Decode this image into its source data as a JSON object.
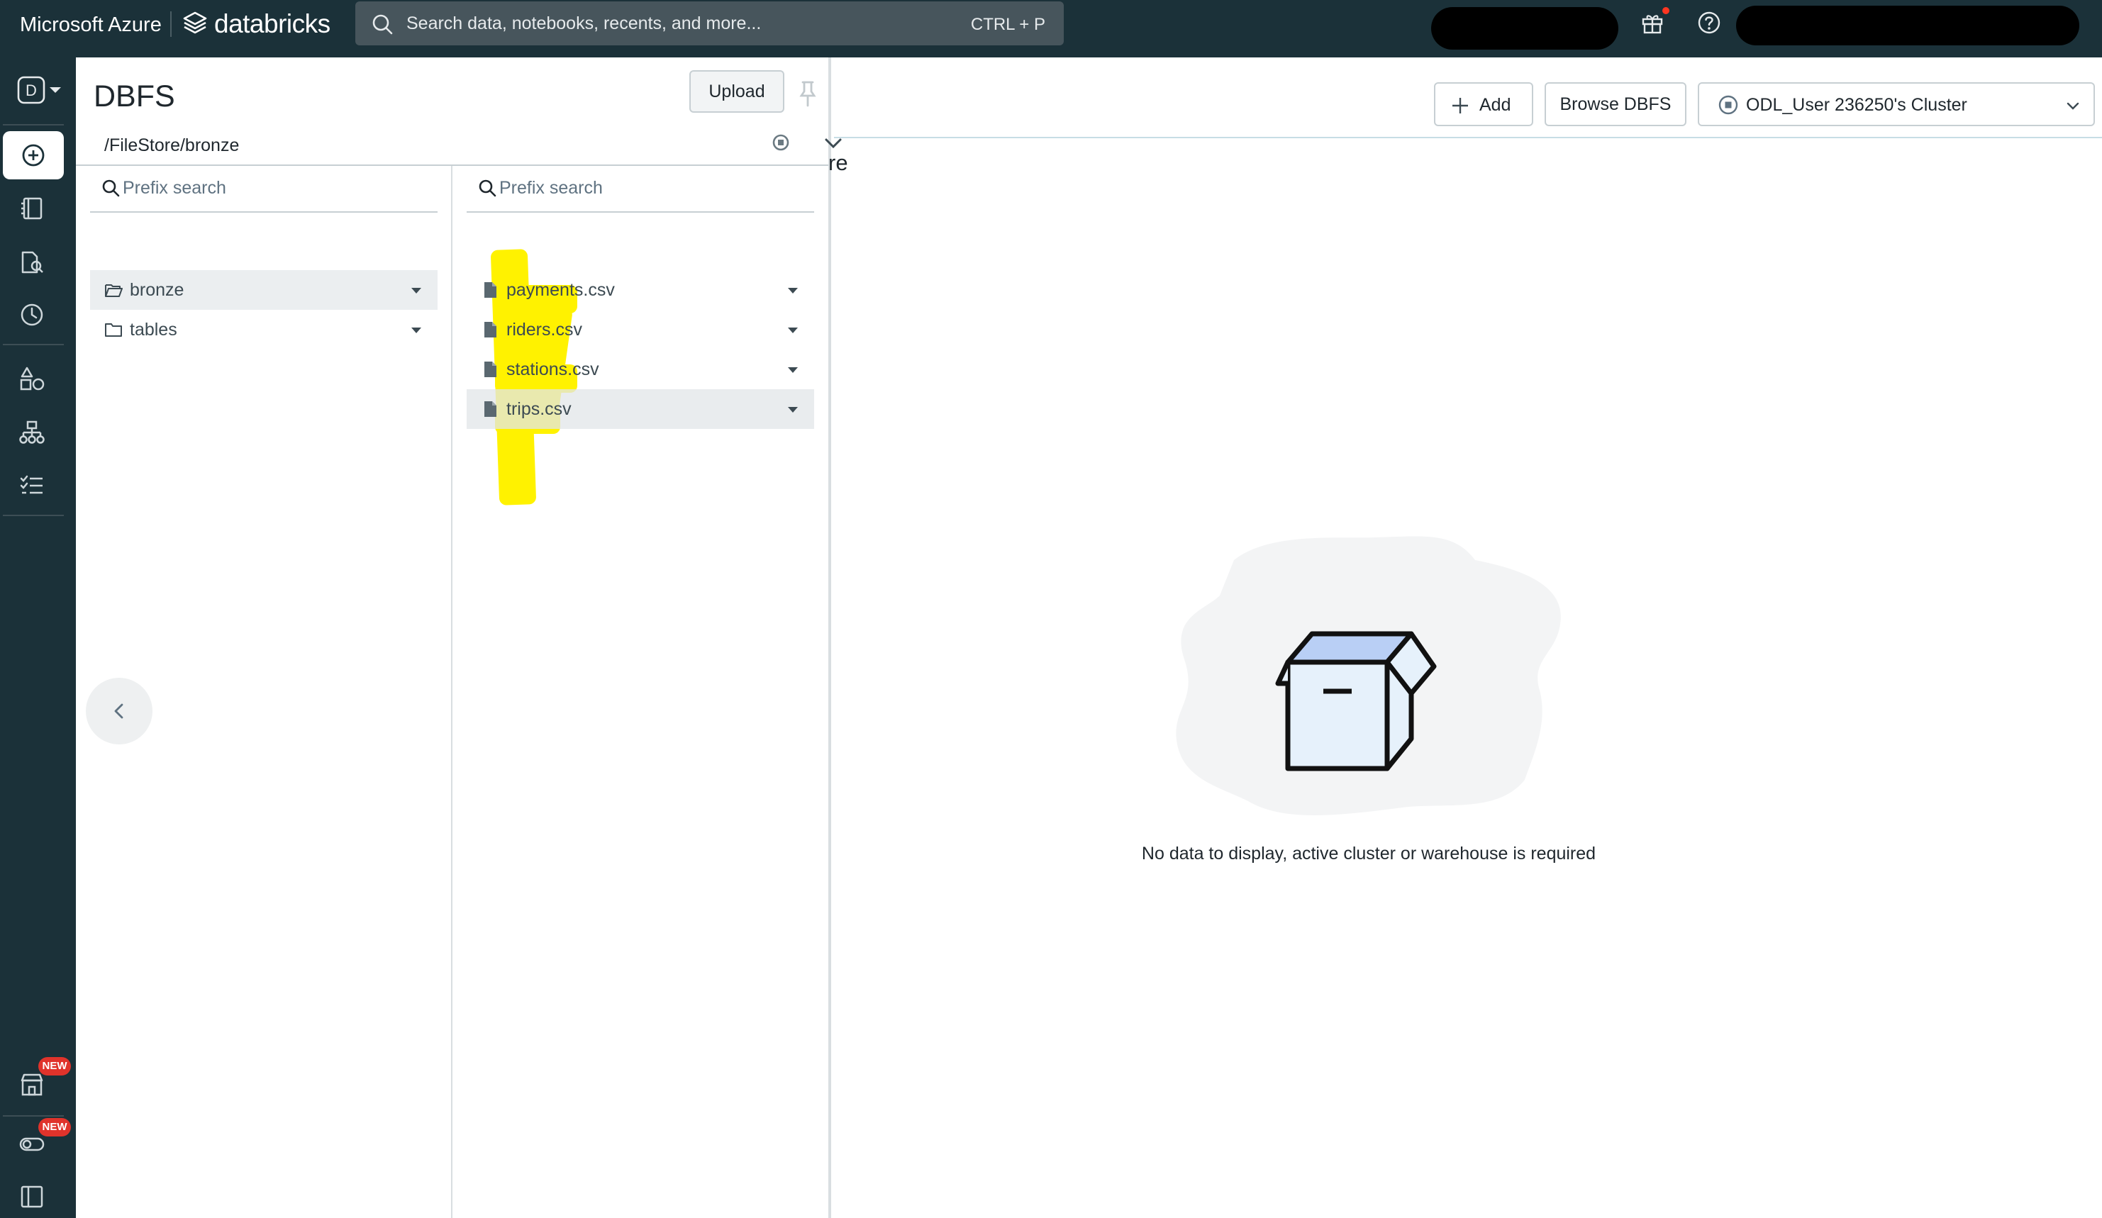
{
  "topbar": {
    "brand_azure": "Microsoft Azure",
    "brand_databricks": "databricks",
    "search_placeholder": "Search data, notebooks, recents, and more...",
    "search_shortcut": "CTRL + P"
  },
  "rail": {
    "workspace_letter": "D",
    "badges": [
      "NEW",
      "NEW"
    ],
    "icons": [
      "new-icon",
      "workspace-icon",
      "catalog-icon",
      "recents-icon",
      "compute-icon",
      "workflows-icon",
      "tasks-icon",
      "marketplace-icon",
      "partner-connect-icon",
      "sidebar-toggle-icon"
    ]
  },
  "dbfs": {
    "title": "DBFS",
    "upload_label": "Upload",
    "path": "/FileStore/bronze",
    "prefix_placeholder": "Prefix search",
    "folders": [
      {
        "label": "bronze",
        "selected": true
      },
      {
        "label": "tables",
        "selected": false
      }
    ],
    "files": [
      {
        "label": "payments.csv",
        "selected": false
      },
      {
        "label": "riders.csv",
        "selected": false
      },
      {
        "label": "stations.csv",
        "selected": false
      },
      {
        "label": "trips.csv",
        "selected": true
      }
    ]
  },
  "right": {
    "partial_heading": "re",
    "add_label": "Add",
    "browse_label": "Browse DBFS",
    "cluster_label": "ODL_User 236250's Cluster",
    "empty_message": "No data to display, active cluster or warehouse is required"
  },
  "colors": {
    "topbar": "#1b3139",
    "search_bg": "#47555c",
    "highlight": "#fff200",
    "badge": "#e0332b",
    "box_fill": "#e6f1fb",
    "box_top": "#b9cff5"
  }
}
